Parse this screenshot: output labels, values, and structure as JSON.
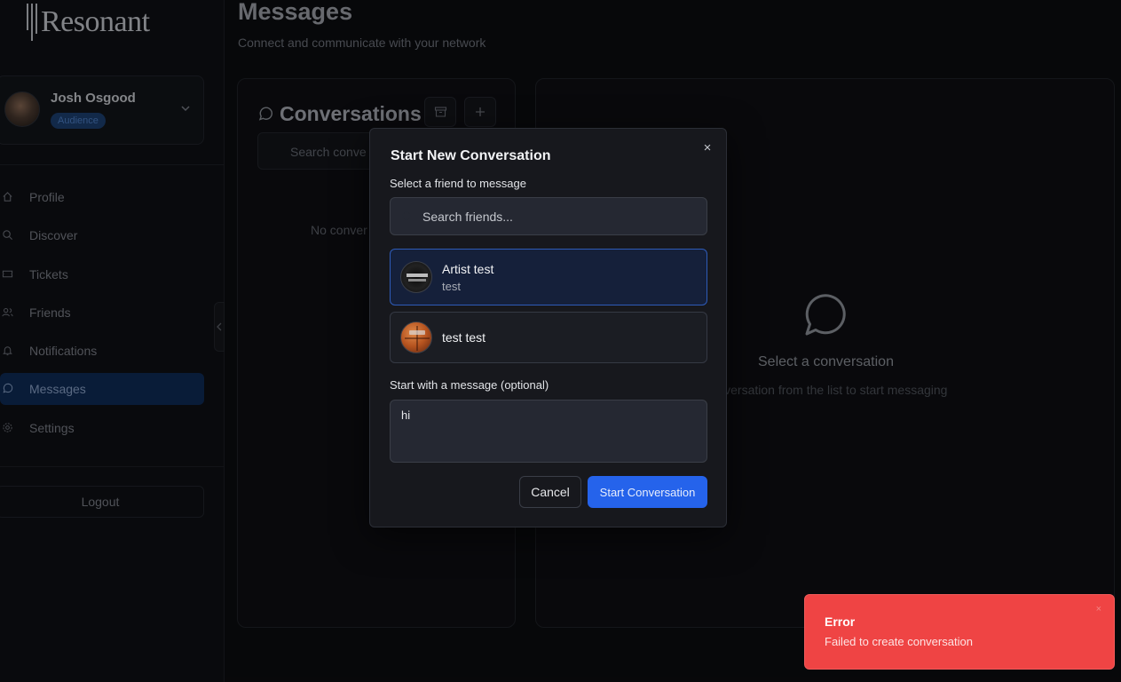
{
  "app": {
    "brand": "Resonant"
  },
  "user": {
    "name": "Josh Osgood",
    "role_badge": "Audience"
  },
  "sidebar": {
    "items": [
      {
        "label": "Profile",
        "icon": "home-icon"
      },
      {
        "label": "Discover",
        "icon": "search-icon"
      },
      {
        "label": "Tickets",
        "icon": "ticket-icon"
      },
      {
        "label": "Friends",
        "icon": "users-icon"
      },
      {
        "label": "Notifications",
        "icon": "bell-icon"
      },
      {
        "label": "Messages",
        "icon": "message-circle-icon",
        "active": true
      },
      {
        "label": "Settings",
        "icon": "gear-icon"
      }
    ],
    "logout_label": "Logout"
  },
  "page": {
    "title": "Messages",
    "subtitle": "Connect and communicate with your network"
  },
  "conversations": {
    "title": "Conversations",
    "search_placeholder": "Search conve",
    "empty_text": "No conver"
  },
  "chat": {
    "empty_title": "Select a conversation",
    "empty_subtitle": "conversation from the list to start messaging"
  },
  "modal": {
    "title": "Start New Conversation",
    "close_glyph": "×",
    "select_label": "Select a friend to message",
    "search_placeholder": "Search friends...",
    "friends": [
      {
        "name": "Artist test",
        "username": "test",
        "selected": true
      },
      {
        "name": "test test",
        "username": "",
        "selected": false
      }
    ],
    "message_label": "Start with a message (optional)",
    "message_value": "hi",
    "cancel_label": "Cancel",
    "submit_label": "Start Conversation"
  },
  "toast": {
    "title": "Error",
    "message": "Failed to create conversation",
    "close_glyph": "×"
  },
  "colors": {
    "accent": "#2563eb",
    "active_nav": "#0f2b57",
    "error": "#ef4444",
    "background": "#0c0d10"
  }
}
